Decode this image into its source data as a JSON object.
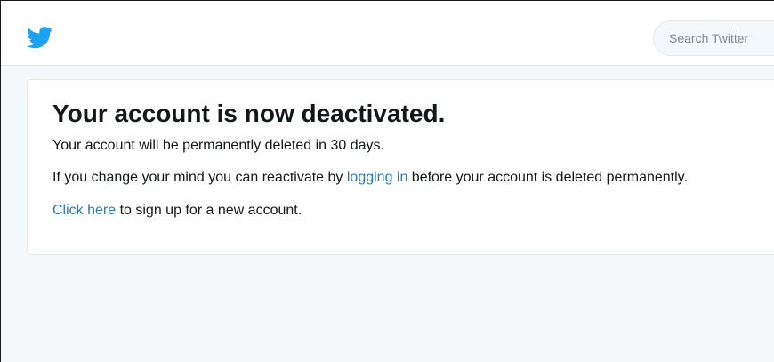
{
  "header": {
    "logo_icon": "twitter-bird-icon",
    "brand_color": "#1da1f2",
    "search": {
      "placeholder": "Search Twitter",
      "value": ""
    }
  },
  "message": {
    "title": "Your account is now deactivated.",
    "deletion_notice": "Your account will be permanently deleted in 30 days.",
    "reactivate_prefix": "If you change your mind you can reactivate by ",
    "reactivate_link": "logging in",
    "reactivate_suffix": " before your account is deleted permanently.",
    "signup_link": "Click here",
    "signup_suffix": " to sign up for a new account."
  },
  "colors": {
    "link": "#2b7bb9",
    "text": "#14171a",
    "page_background": "#f5f8fa"
  }
}
